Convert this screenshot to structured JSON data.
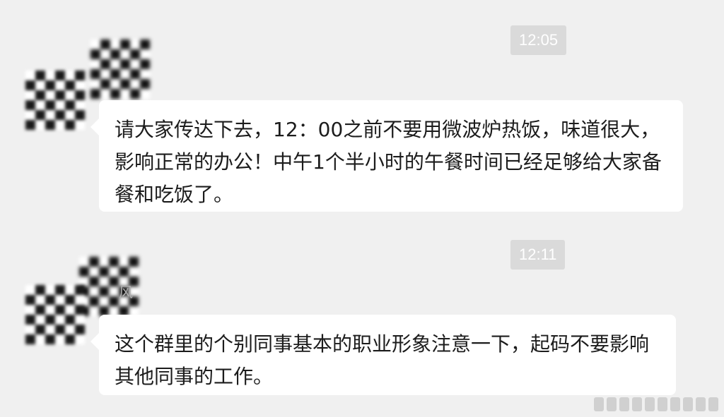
{
  "messages": [
    {
      "time": "12:05",
      "sender_name": "",
      "text": "请大家传达下去，12：00之前不要用微波炉热饭，味道很大，影响正常的办公！中午1个半小时的午餐时间已经足够给大家备餐和吃饭了。"
    },
    {
      "time": "12:11",
      "sender_name": "风",
      "text": "这个群里的个别同事基本的职业形象注意一下，起码不要影响其他同事的工作。"
    }
  ],
  "icons": {
    "avatar": "avatar-mosaic",
    "name_redaction": "mosaic-redaction"
  },
  "colors": {
    "background": "#f0f0f0",
    "bubble": "#ffffff",
    "timestamp_bg": "#dadada",
    "timestamp_text": "#ffffff"
  }
}
